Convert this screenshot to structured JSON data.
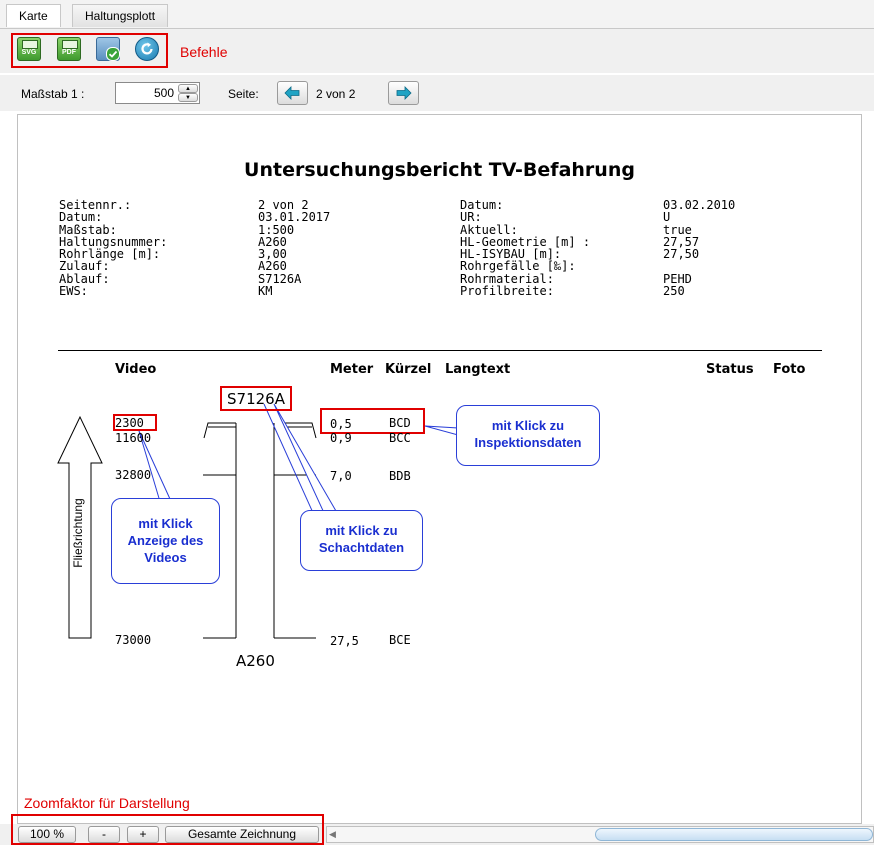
{
  "tabs": [
    {
      "label": "Karte"
    },
    {
      "label": "Haltungsplott"
    }
  ],
  "toolbar": {
    "svg_label": "SVG",
    "pdf_label": "PDF",
    "annotation": "Befehle"
  },
  "scale": {
    "label": "Maßstab 1 :",
    "value": "500",
    "page_label": "Seite:",
    "page_value": "2 von 2"
  },
  "report": {
    "title": "Untersuchungsbericht TV-Befahrung",
    "left_labels": [
      "Seitennr.:",
      "Datum:",
      "Maßstab:",
      "Haltungsnummer:",
      "Rohrlänge [m]:",
      "Zulauf:",
      "Ablauf:",
      "EWS:"
    ],
    "left_values": [
      "2 von 2",
      "03.01.2017",
      "1:500",
      "A260",
      "3,00",
      "A260",
      "S7126A",
      "KM"
    ],
    "right_labels": [
      "Datum:",
      "UR:",
      "Aktuell:",
      "HL-Geometrie [m] :",
      "HL-ISYBAU [m]:",
      "Rohrgefälle [‰]:",
      "Rohrmaterial:",
      "Profilbreite:"
    ],
    "right_values": [
      "03.02.2010",
      "U",
      "true",
      "27,57",
      "27,50",
      "",
      "PEHD",
      "250"
    ],
    "columns": {
      "video": "Video",
      "meter": "Meter",
      "kuerzel": "Kürzel",
      "langtext": "Langtext",
      "status": "Status",
      "foto": "Foto"
    },
    "rows": [
      {
        "video": "2300",
        "meter": "0,5",
        "code": "BCD"
      },
      {
        "video": "11600",
        "meter": "0,9",
        "code": "BCC"
      },
      {
        "video": "32800",
        "meter": "7,0",
        "code": "BDB"
      },
      {
        "video": "73000",
        "meter": "27,5",
        "code": "BCE"
      }
    ],
    "top_node": "S7126A",
    "bottom_node": "A260",
    "flow_label": "Fließrichtung"
  },
  "callouts": {
    "video": "mit Klick Anzeige des Videos",
    "schacht": "mit Klick zu Schachtdaten",
    "inspektion": "mit Klick zu Inspektionsdaten"
  },
  "zoom": {
    "annotation": "Zoomfaktor für Darstellung",
    "percent": "100 %",
    "minus": "-",
    "plus": "+",
    "fit": "Gesamte Zeichnung"
  },
  "colors": {
    "highlight": "#e00000",
    "callout": "#2a3fd8"
  }
}
